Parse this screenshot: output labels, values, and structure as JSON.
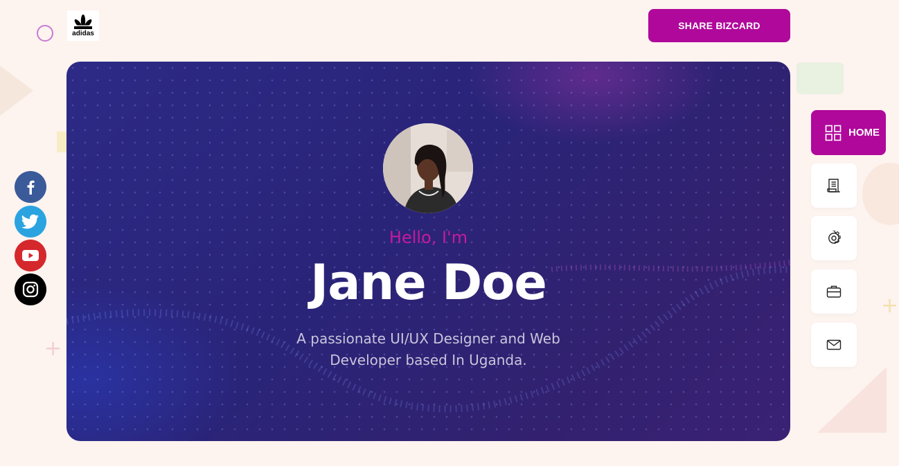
{
  "header": {
    "brand_logo_text": "adidas",
    "share_label": "SHARE BIZCARD"
  },
  "hero": {
    "greeting": "Hello, I'm",
    "name": "Jane Doe",
    "tagline": "A passionate UI/UX Designer and Web Developer based In Uganda."
  },
  "social": [
    {
      "icon": "facebook-icon",
      "color": "#3a5a99"
    },
    {
      "icon": "twitter-icon",
      "color": "#2aa3e0"
    },
    {
      "icon": "youtube-icon",
      "color": "#d4282c"
    },
    {
      "icon": "instagram-icon",
      "color": "#000000"
    }
  ],
  "nav": {
    "home_label": "HOME",
    "items": [
      {
        "icon": "grid-icon",
        "label": "HOME",
        "active": true
      },
      {
        "icon": "resume-icon"
      },
      {
        "icon": "gear-icon"
      },
      {
        "icon": "briefcase-icon"
      },
      {
        "icon": "mail-icon"
      }
    ]
  },
  "colors": {
    "accent": "#b0089b",
    "greeting": "#c81a9e",
    "background": "#fdf3ef",
    "hero": "#2c2a86"
  }
}
